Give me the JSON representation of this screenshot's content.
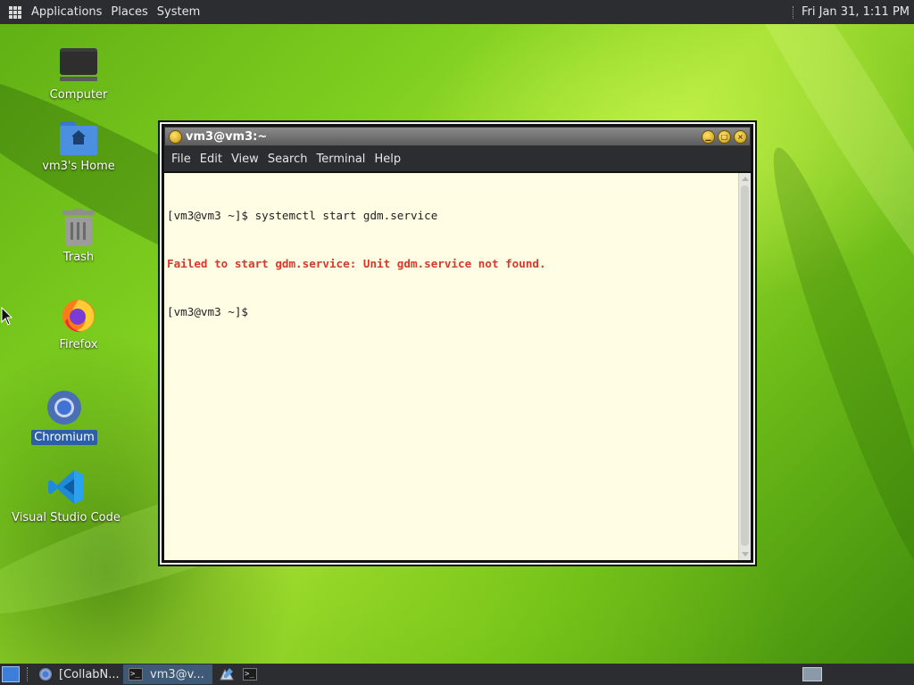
{
  "top_panel": {
    "menus": [
      "Applications",
      "Places",
      "System"
    ],
    "clock": "Fri Jan 31, 1:11 PM"
  },
  "desktop": {
    "icons": [
      {
        "name": "computer",
        "label": "Computer"
      },
      {
        "name": "home-folder",
        "label": "vm3's Home"
      },
      {
        "name": "trash",
        "label": "Trash"
      },
      {
        "name": "firefox",
        "label": "Firefox"
      },
      {
        "name": "chromium",
        "label": "Chromium",
        "selected": true
      },
      {
        "name": "vscode",
        "label": "Visual Studio Code"
      }
    ]
  },
  "terminal": {
    "title": "vm3@vm3:~",
    "menu": [
      "File",
      "Edit",
      "View",
      "Search",
      "Terminal",
      "Help"
    ],
    "lines": {
      "line1": "[vm3@vm3 ~]$ systemctl start gdm.service",
      "line2": "Failed to start gdm.service: Unit gdm.service not found.",
      "line3": "[vm3@vm3 ~]$ "
    },
    "error_color": "#d63a28",
    "background_color": "#fffde3"
  },
  "taskbar": {
    "tasks": [
      {
        "label": "[CollabN...",
        "active": false
      },
      {
        "label": "vm3@v...",
        "active": true
      }
    ],
    "terminal_glyph": ">_"
  },
  "colors": {
    "panel": "#2b2d30",
    "selection": "#2c5fa8",
    "active_task": "#3e5a76"
  }
}
